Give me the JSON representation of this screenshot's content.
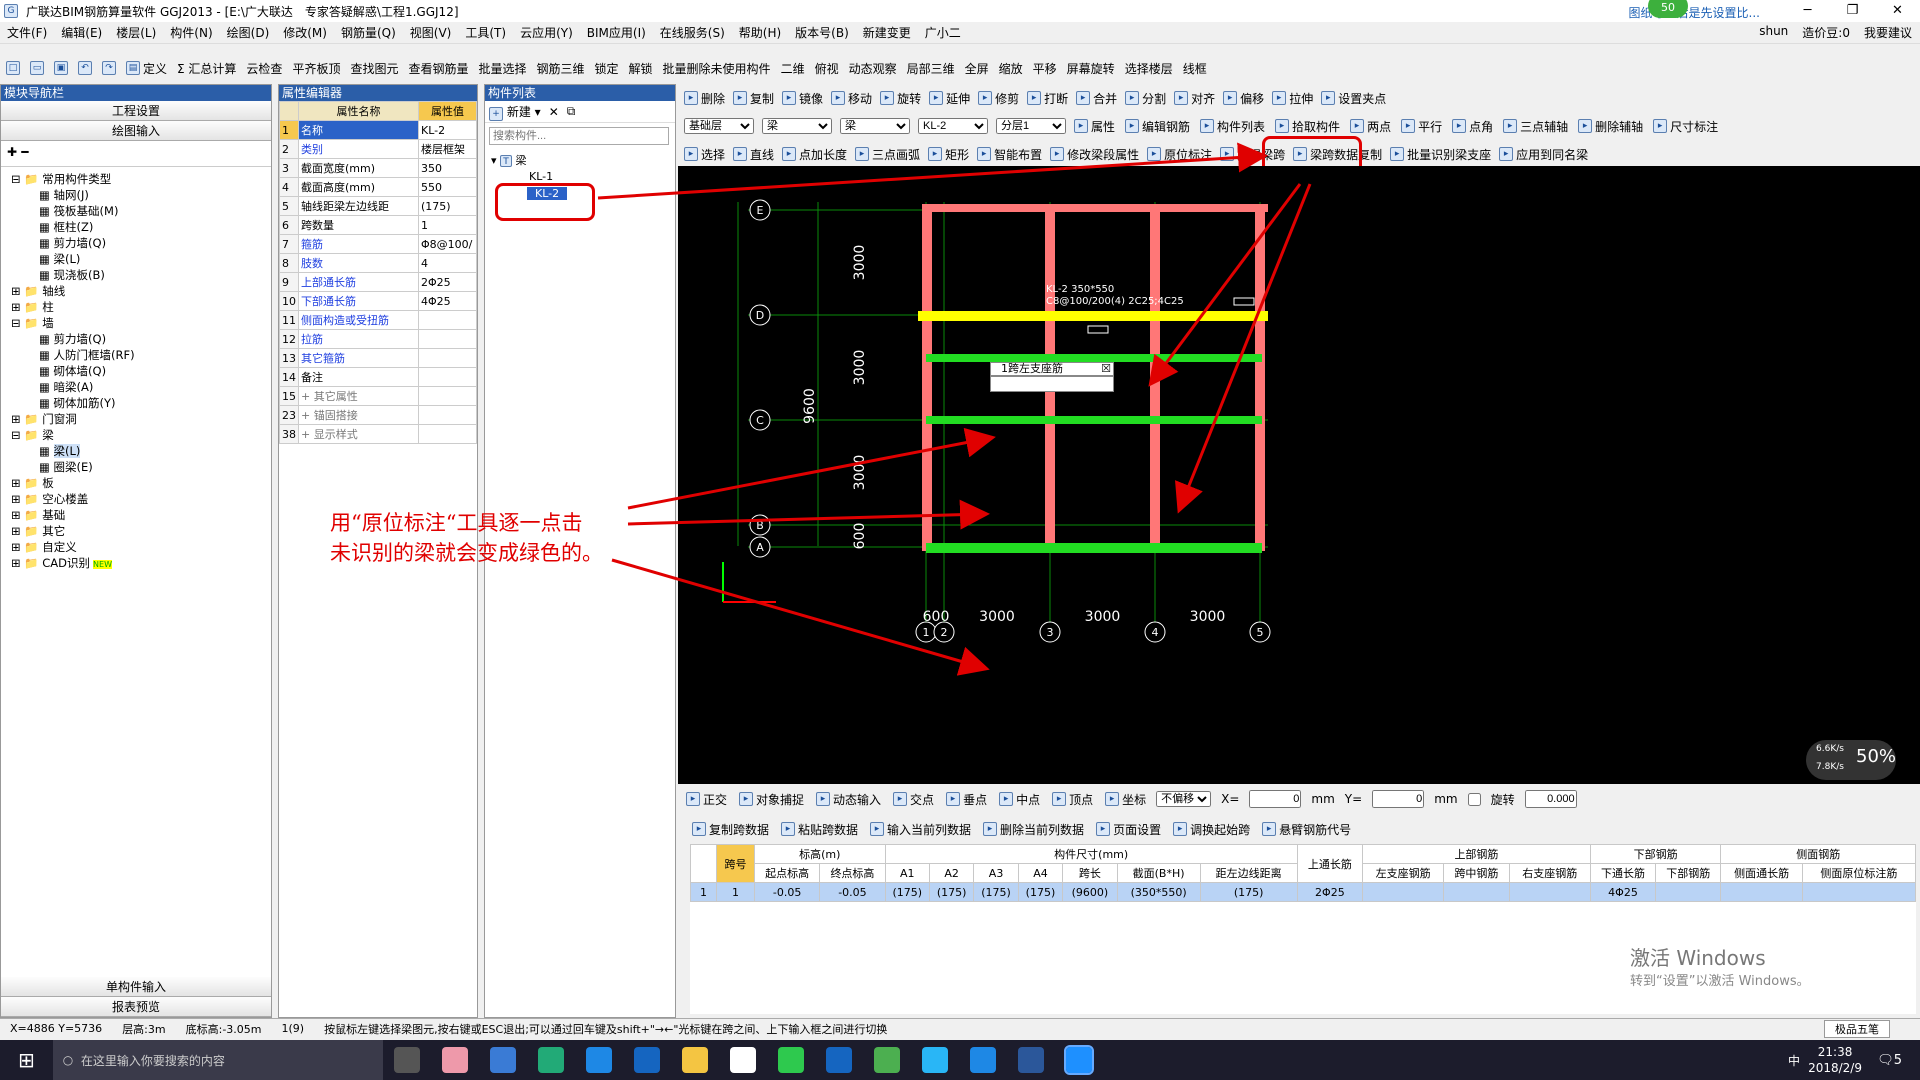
{
  "window": {
    "title": "广联达BIM钢筋算量软件 GGJ2013 - [E:\\广大联达　专家答疑解惑\\工程1.GGJ12]",
    "notice": "图纸导入后是先设置比...",
    "user": "shun",
    "cost_label": "造价豆:0",
    "help_label": "我要建议",
    "badge": "50"
  },
  "menu": [
    "文件(F)",
    "编辑(E)",
    "楼层(L)",
    "构件(N)",
    "绘图(D)",
    "修改(M)",
    "钢筋量(Q)",
    "视图(V)",
    "工具(T)",
    "云应用(Y)",
    "BIM应用(I)",
    "在线服务(S)",
    "帮助(H)",
    "版本号(B)",
    "新建变更",
    "广小二"
  ],
  "toolbar1": [
    "定义",
    "Σ 汇总计算",
    "云检查",
    "平齐板顶",
    "查找图元",
    "查看钢筋量",
    "批量选择",
    "钢筋三维",
    "锁定",
    "解锁",
    "批量删除未使用构件",
    "二维",
    "俯视",
    "动态观察",
    "局部三维",
    "全屏",
    "缩放",
    "平移",
    "屏幕旋转",
    "选择楼层",
    "线框"
  ],
  "nav": {
    "title": "模块导航栏",
    "btn_project": "工程设置",
    "btn_draw": "绘图输入",
    "tree": [
      {
        "t": "常用构件类型",
        "l": 0,
        "o": "-"
      },
      {
        "t": "轴网(J)",
        "l": 2
      },
      {
        "t": "筏板基础(M)",
        "l": 2
      },
      {
        "t": "框柱(Z)",
        "l": 2
      },
      {
        "t": "剪力墙(Q)",
        "l": 2
      },
      {
        "t": "梁(L)",
        "l": 2
      },
      {
        "t": "现浇板(B)",
        "l": 2
      },
      {
        "t": "轴线",
        "l": 0,
        "o": "+"
      },
      {
        "t": "柱",
        "l": 0,
        "o": "+"
      },
      {
        "t": "墙",
        "l": 0,
        "o": "-"
      },
      {
        "t": "剪力墙(Q)",
        "l": 2
      },
      {
        "t": "人防门框墙(RF)",
        "l": 2
      },
      {
        "t": "砌体墙(Q)",
        "l": 2
      },
      {
        "t": "暗梁(A)",
        "l": 2
      },
      {
        "t": "砌体加筋(Y)",
        "l": 2
      },
      {
        "t": "门窗洞",
        "l": 0,
        "o": "+"
      },
      {
        "t": "梁",
        "l": 0,
        "o": "-"
      },
      {
        "t": "梁(L)",
        "l": 2,
        "sel": true
      },
      {
        "t": "圈梁(E)",
        "l": 2
      },
      {
        "t": "板",
        "l": 0,
        "o": "+"
      },
      {
        "t": "空心楼盖",
        "l": 0,
        "o": "+"
      },
      {
        "t": "基础",
        "l": 0,
        "o": "+"
      },
      {
        "t": "其它",
        "l": 0,
        "o": "+"
      },
      {
        "t": "自定义",
        "l": 0,
        "o": "+"
      },
      {
        "t": "CAD识别",
        "l": 0,
        "o": "+",
        "new": "NEW"
      }
    ],
    "btn_single": "单构件输入",
    "btn_report": "报表预览"
  },
  "props": {
    "title": "属性编辑器",
    "col_name": "属性名称",
    "col_value": "属性值",
    "rows": [
      {
        "n": "1",
        "name": "名称",
        "value": "KL-2",
        "blue": true
      },
      {
        "n": "2",
        "name": "类别",
        "value": "楼层框架",
        "blue": true
      },
      {
        "n": "3",
        "name": "截面宽度(mm)",
        "value": "350"
      },
      {
        "n": "4",
        "name": "截面高度(mm)",
        "value": "550"
      },
      {
        "n": "5",
        "name": "轴线距梁左边线距",
        "value": "(175)"
      },
      {
        "n": "6",
        "name": "跨数量",
        "value": "1"
      },
      {
        "n": "7",
        "name": "箍筋",
        "value": "Φ8@100/",
        "blue": true
      },
      {
        "n": "8",
        "name": "肢数",
        "value": "4",
        "blue": true
      },
      {
        "n": "9",
        "name": "上部通长筋",
        "value": "2Φ25",
        "blue": true
      },
      {
        "n": "10",
        "name": "下部通长筋",
        "value": "4Φ25",
        "blue": true
      },
      {
        "n": "11",
        "name": "侧面构造或受扭筋",
        "value": "",
        "blue": true
      },
      {
        "n": "12",
        "name": "拉筋",
        "value": "",
        "blue": true
      },
      {
        "n": "13",
        "name": "其它箍筋",
        "value": "",
        "blue": true
      },
      {
        "n": "14",
        "name": "备注",
        "value": ""
      },
      {
        "n": "15",
        "name": "+ 其它属性",
        "value": "",
        "gray": true
      },
      {
        "n": "23",
        "name": "+ 锚固搭接",
        "value": "",
        "gray": true
      },
      {
        "n": "38",
        "name": "+ 显示样式",
        "value": "",
        "gray": true
      }
    ]
  },
  "complist": {
    "title": "构件列表",
    "new_label": "新建",
    "search_placeholder": "搜索构件...",
    "root": "梁",
    "items": [
      "KL-1",
      "KL-2"
    ]
  },
  "ribbon": {
    "row1": [
      "删除",
      "复制",
      "镜像",
      "移动",
      "旋转",
      "延伸",
      "修剪",
      "打断",
      "合并",
      "分割",
      "对齐",
      "偏移",
      "拉伸",
      "设置夹点"
    ],
    "floor": "基础层",
    "type1": "梁",
    "type2": "梁",
    "element": "KL-2",
    "layer": "分层1",
    "row2": [
      "属性",
      "编辑钢筋",
      "构件列表",
      "拾取构件",
      "两点",
      "平行",
      "点角",
      "三点辅轴",
      "删除辅轴",
      "尺寸标注"
    ],
    "row3": [
      "选择",
      "直线",
      "点加长度",
      "三点画弧",
      "矩形",
      "智能布置",
      "修改梁段属性",
      "原位标注",
      "重提梁跨",
      "梁跨数据复制",
      "批量识别梁支座",
      "应用到同名梁"
    ]
  },
  "canvas": {
    "axes_rows": [
      "E",
      "D",
      "C",
      "B",
      "A"
    ],
    "axes_cols": [
      "1",
      "2",
      "3",
      "4",
      "5"
    ],
    "vdims": [
      "3000",
      "3000",
      "3000",
      "600"
    ],
    "total_dim": "9600",
    "hdims": [
      "600",
      "3000",
      "3000",
      "3000"
    ],
    "beam_label_line1": "KL-2  350*550",
    "beam_label_line2": "C8@100/200(4)  2C25;4C25",
    "popup_title": "1跨左支座筋",
    "speed_up": "6.6K/s",
    "speed_down": "7.8K/s",
    "speed_pct": "50%",
    "beam_color": "#ffff00",
    "identified_color": "#22dd22",
    "column_color": "#ff7777"
  },
  "annotation": {
    "line1": "用“原位标注“工具逐一点击",
    "line2": "未识别的梁就会变成绿色的。"
  },
  "snapbar": {
    "items": [
      "正交",
      "对象捕捉",
      "动态输入",
      "交点",
      "垂点",
      "中点",
      "顶点",
      "坐标"
    ],
    "mode": "不偏移",
    "x_label": "X=",
    "x_value": "0",
    "y_label": "Y=",
    "y_value": "0",
    "unit": "mm",
    "rotate_label": "旋转",
    "rotate_value": "0.000"
  },
  "bottombar": [
    "复制跨数据",
    "粘贴跨数据",
    "输入当前列数据",
    "删除当前列数据",
    "页面设置",
    "调换起始跨",
    "悬臂钢筋代号"
  ],
  "span_table": {
    "h_group": [
      "跨号",
      "标高(m)",
      "构件尺寸(mm)",
      "上通长筋",
      "上部钢筋",
      "下部钢筋",
      "侧面钢筋"
    ],
    "h_sub": [
      "起点标高",
      "终点标高",
      "A1",
      "A2",
      "A3",
      "A4",
      "跨长",
      "截面(B*H)",
      "距左边线距离",
      "左支座钢筋",
      "跨中钢筋",
      "右支座钢筋",
      "下通长筋",
      "下部钢筋",
      "侧面通长筋",
      "侧面原位标注筋"
    ],
    "row": {
      "idx": "1",
      "span": "1",
      "start": "-0.05",
      "end": "-0.05",
      "a1": "(175)",
      "a2": "(175)",
      "a3": "(175)",
      "a4": "(175)",
      "len": "(9600)",
      "sect": "(350*550)",
      "dist": "(175)",
      "top": "2Φ25",
      "bottom": "4Φ25"
    }
  },
  "activate": {
    "line1": "激活 Windows",
    "line2": "转到“设置”以激活 Windows。"
  },
  "status": {
    "coords": "X=4886 Y=5736",
    "floor_h": "层高:3m",
    "base_h": "底标高:-3.05m",
    "count": "1(9)",
    "hint": "按鼠标左键选择梁图元,按右键或ESC退出;可以通过回车键及shift+\"→←\"光标键在跨之间、上下输入框之间进行切换",
    "ime": "极品五笔"
  },
  "taskbar": {
    "search_placeholder": "在这里输入你要搜索的内容",
    "time": "21:38",
    "date": "2018/2/9",
    "notif": "5",
    "lang": "中"
  }
}
